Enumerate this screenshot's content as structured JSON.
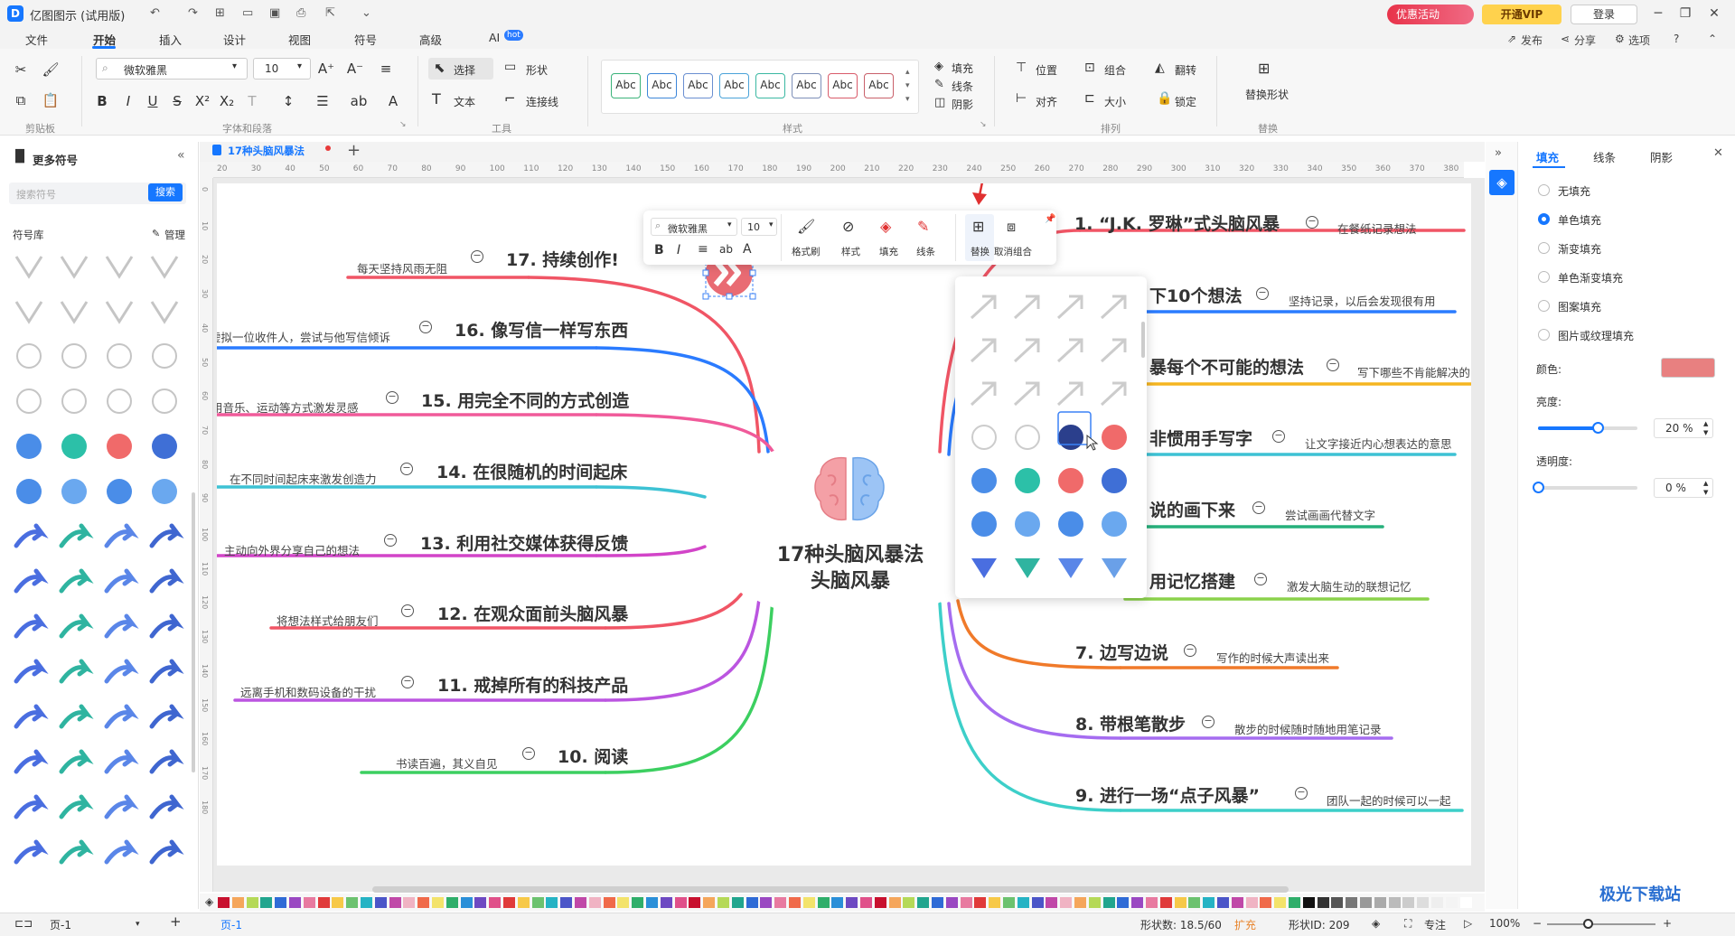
{
  "app": {
    "title": "亿图图示 (试用版)"
  },
  "titlebar": {
    "promo": "优惠活动",
    "vip": "开通VIP",
    "login": "登录"
  },
  "menu": {
    "tabs": [
      "文件",
      "开始",
      "插入",
      "设计",
      "视图",
      "符号",
      "高级",
      "AI"
    ],
    "hot": "hot",
    "right": [
      "发布",
      "分享",
      "选项"
    ]
  },
  "ribbon": {
    "font_name": "微软雅黑",
    "font_size": "10",
    "select": "选择",
    "shape": "形状",
    "text": "文本",
    "connector": "连接线",
    "style_sample": "Abc",
    "fill": "填充",
    "line": "线条",
    "shadow": "阴影",
    "position": "位置",
    "group": "组合",
    "flip": "翻转",
    "align": "对齐",
    "size": "大小",
    "lock": "锁定",
    "replace_shape": "替换形状",
    "groups": [
      "剪贴板",
      "字体和段落",
      "工具",
      "样式",
      "排列",
      "替换"
    ]
  },
  "left_panel": {
    "title": "更多符号",
    "search_placeholder": "搜索符号",
    "search_btn": "搜索",
    "library": "符号库",
    "manage": "管理"
  },
  "doc": {
    "tab": "17种头脑风暴法"
  },
  "ruler": {
    "h": [
      "20",
      "30",
      "40",
      "50",
      "60",
      "70",
      "80",
      "90",
      "100",
      "110",
      "120",
      "130",
      "140",
      "150",
      "160",
      "170",
      "180",
      "190",
      "200",
      "210",
      "220",
      "230",
      "240",
      "250",
      "260",
      "270",
      "280",
      "290",
      "300",
      "310",
      "320",
      "330",
      "340",
      "350",
      "360",
      "370",
      "380"
    ],
    "v": [
      "0",
      "10",
      "20",
      "30",
      "40",
      "50",
      "60",
      "70",
      "80",
      "90",
      "100",
      "110",
      "120",
      "130",
      "140",
      "150",
      "160",
      "170",
      "180"
    ]
  },
  "mindmap": {
    "center1": "17种头脑风暴法",
    "center2": "头脑风暴",
    "left": [
      {
        "t": "17. 持续创作!",
        "n": "每天坚持风雨无阻"
      },
      {
        "t": "16. 像写信一样写东西",
        "n": "虚拟一位收件人，尝试与他写信倾诉"
      },
      {
        "t": "15. 用完全不同的方式创造",
        "n": "用音乐、运动等方式激发灵感"
      },
      {
        "t": "14. 在很随机的时间起床",
        "n": "在不同时间起床来激发创造力"
      },
      {
        "t": "13. 利用社交媒体获得反馈",
        "n": "主动向外界分享自己的想法"
      },
      {
        "t": "12. 在观众面前头脑风暴",
        "n": "将想法样式给朋友们"
      },
      {
        "t": "11. 戒掉所有的科技产品",
        "n": "远离手机和数码设备的干扰"
      },
      {
        "t": "10. 阅读",
        "n": "书读百遍，其义自见"
      }
    ],
    "right": [
      {
        "t": "1. “J.K. 罗琳”式头脑风暴",
        "n": "在餐纸记录想法"
      },
      {
        "t": "下10个想法",
        "n": "坚持记录，以后会发现很有用"
      },
      {
        "t": "暴每个不可能的想法",
        "n": "写下哪些不肯能解决的"
      },
      {
        "t": "非惯用手写字",
        "n": "让文字接近内心想表达的意思"
      },
      {
        "t": "说的画下来",
        "n": "尝试画画代替文字"
      },
      {
        "t": "用记忆搭建",
        "n": "激发大脑生动的联想记忆"
      },
      {
        "t": "7. 边写边说",
        "n": "写作的时候大声读出来"
      },
      {
        "t": "8. 带根笔散步",
        "n": "散步的时候随时随地用笔记录"
      },
      {
        "t": "9. 进行一场“点子风暴”",
        "n": "团队一起的时候可以一起"
      }
    ]
  },
  "floatbar": {
    "font": "微软雅黑",
    "size": "10",
    "labels": [
      "格式刷",
      "样式",
      "填充",
      "线条",
      "替换",
      "取消组合"
    ]
  },
  "right_panel": {
    "tabs": [
      "填充",
      "线条",
      "阴影"
    ],
    "options": [
      "无填充",
      "单色填充",
      "渐变填充",
      "单色渐变填充",
      "图案填充",
      "图片或纹理填充"
    ],
    "color_label": "颜色:",
    "color": "#e88080",
    "brightness_label": "亮度:",
    "brightness": "20 %",
    "transparency_label": "透明度:",
    "transparency": "0 %"
  },
  "status": {
    "page": "页-1",
    "page_tab": "页-1",
    "shapes": "形状数: 18.5/60",
    "expand": "扩充",
    "shape_id": "形状ID: 209",
    "focus": "专注",
    "zoom": "100%"
  },
  "watermark": "极光下载站"
}
